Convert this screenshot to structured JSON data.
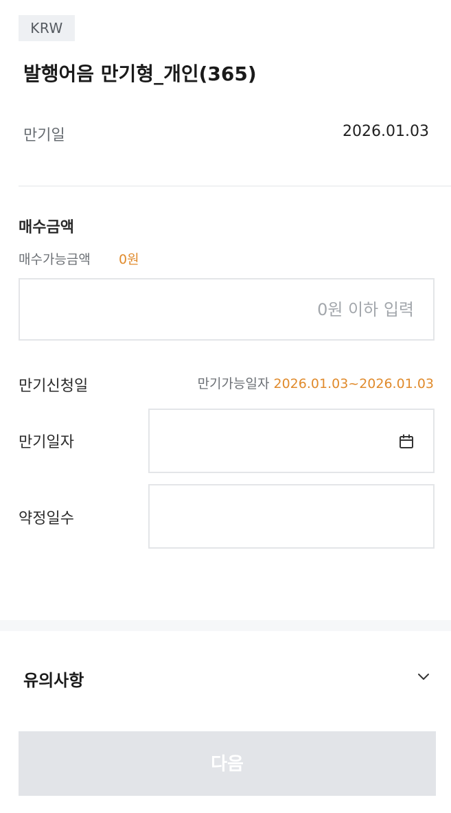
{
  "currency": "KRW",
  "product": {
    "title": "발행어음 만기형_개인(365)",
    "maturity_label": "만기일",
    "maturity_value": "2026.01.03"
  },
  "purchase": {
    "section_title": "매수금액",
    "available_label": "매수가능금액",
    "available_value": "0원",
    "amount_placeholder": "0원 이하 입력",
    "amount_value": ""
  },
  "maturity_request": {
    "section_label": "만기신청일",
    "range_label": "만기가능일자",
    "range_value": "2026.01.03~2026.01.03",
    "date_label": "만기일자",
    "date_value": "",
    "date_icon": "calendar-icon",
    "days_label": "약정일수",
    "days_value": ""
  },
  "notice": {
    "title": "유의사항",
    "expand_icon": "chevron-down-icon",
    "expanded": false
  },
  "actions": {
    "next_label": "다음",
    "next_enabled": false
  },
  "colors": {
    "accent": "#e08a2b",
    "disabled_button": "#e2e4e8",
    "badge_bg": "#eef0f3"
  }
}
